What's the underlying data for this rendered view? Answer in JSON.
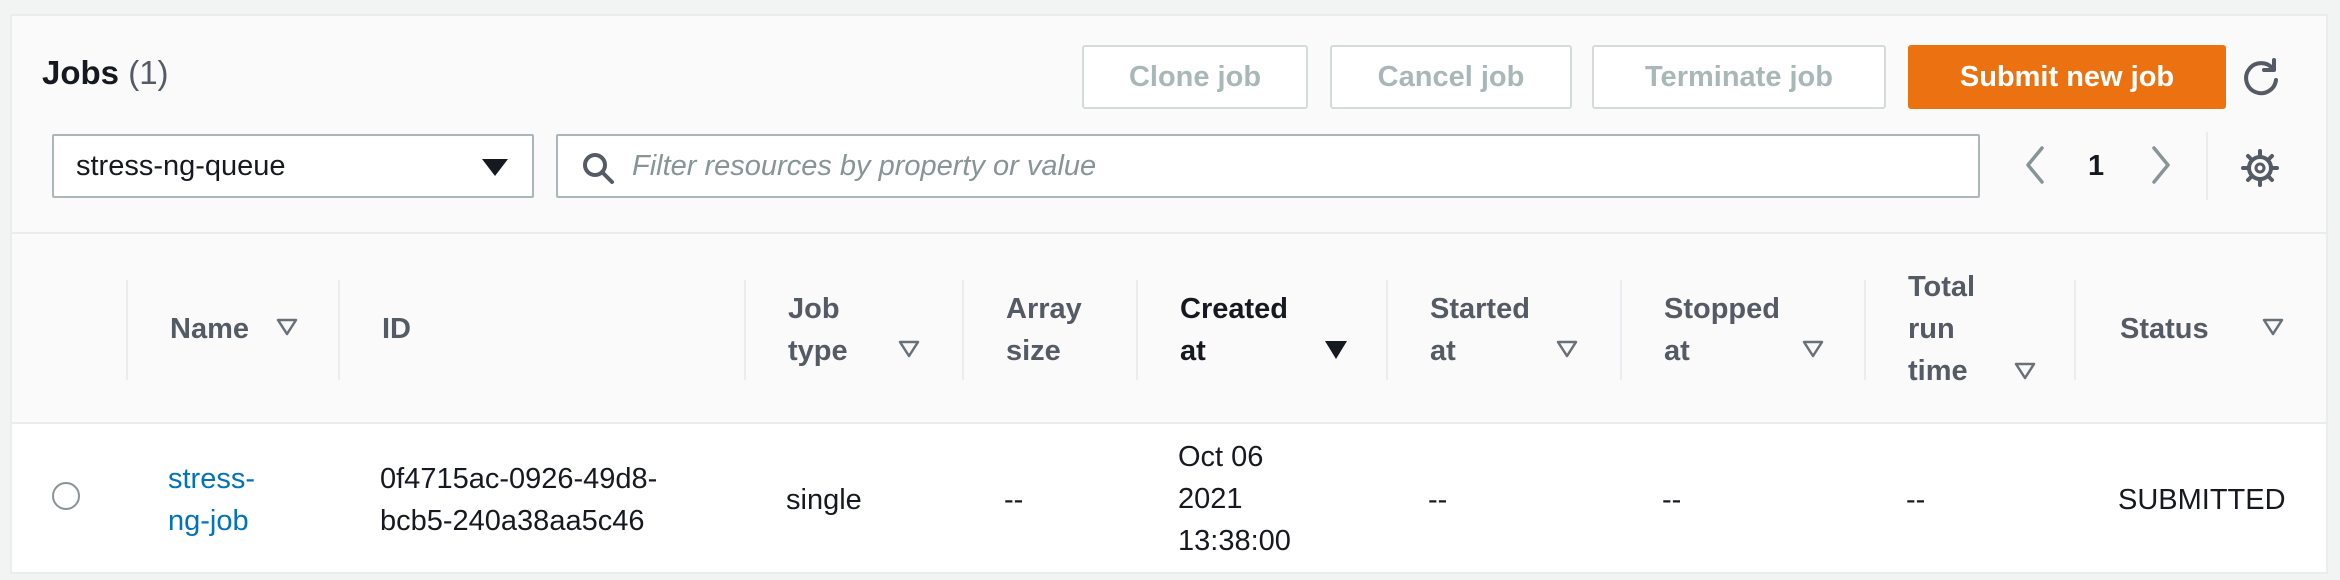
{
  "header": {
    "title": "Jobs",
    "count": "(1)"
  },
  "actions": {
    "clone": "Clone job",
    "cancel": "Cancel job",
    "terminate": "Terminate job",
    "submit": "Submit new job"
  },
  "queue_select": {
    "value": "stress-ng-queue"
  },
  "filter": {
    "placeholder": "Filter resources by property or value"
  },
  "pagination": {
    "current_page": "1"
  },
  "table": {
    "columns": {
      "name": "Name",
      "id": "ID",
      "job_type_1": "Job",
      "job_type_2": "type",
      "array_size_1": "Array",
      "array_size_2": "size",
      "created_at_1": "Created",
      "created_at_2": "at",
      "started_at_1": "Started",
      "started_at_2": "at",
      "stopped_at_1": "Stopped",
      "stopped_at_2": "at",
      "total_run_time_1": "Total",
      "total_run_time_2": "run",
      "total_run_time_3": "time",
      "status": "Status"
    },
    "rows": [
      {
        "name_1": "stress-",
        "name_2": "ng-job",
        "id_1": "0f4715ac-0926-49d8-",
        "id_2": "bcb5-240a38aa5c46",
        "job_type": "single",
        "array_size": "--",
        "created_1": "Oct 06",
        "created_2": "2021",
        "created_3": "13:38:00",
        "started_at": "--",
        "stopped_at": "--",
        "total_run_time": "--",
        "status": "SUBMITTED"
      }
    ]
  },
  "colors": {
    "primary": "#ec7211",
    "link": "#0073bb",
    "text": "#16191f"
  }
}
